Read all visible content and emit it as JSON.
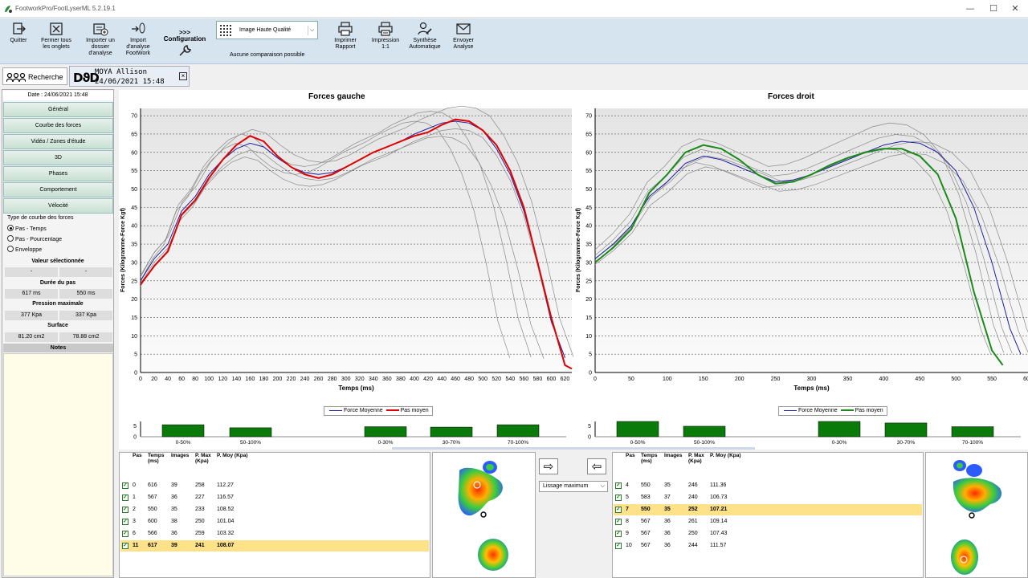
{
  "window": {
    "title": "FootworkPro/FootLyserML 5.2.19.1",
    "minimize": "—",
    "maximize": "☐",
    "close": "✕"
  },
  "ribbon": {
    "quit": "Quitter",
    "close_tabs": [
      "Fermer tous",
      "les onglets"
    ],
    "import_folder": [
      "Importer un",
      "dossier",
      "d'analyse"
    ],
    "import_fw": [
      "Import",
      "d'analyse",
      "FootWork"
    ],
    "config_arrows": ">>>",
    "config": "Configuration",
    "quality": "Image Haute Qualité",
    "no_compare": "Aucune comparaison possible",
    "print_report": [
      "Imprimer",
      "Rapport"
    ],
    "print_11": [
      "Impression",
      "1:1"
    ],
    "synthesis": [
      "Synthèse",
      "Automatique"
    ],
    "send": [
      "Envoyer",
      "Analyse"
    ]
  },
  "tabs": {
    "search": "Recherche",
    "patient_logo": "DϑD",
    "patient_name": "MOYA Allison",
    "patient_date": "24/06/2021 15:48",
    "close": "×"
  },
  "left": {
    "date": "Date : 24/06/2021 15:48",
    "nav": [
      "Général",
      "Courbe des forces",
      "Vidéo / Zones d'étude",
      "3D",
      "Phases",
      "Comportement",
      "Vélocité"
    ],
    "curve_type_title": "Type de courbe des forces",
    "radios": [
      "Pas - Temps",
      "Pas - Pourcentage",
      "Enveloppe"
    ],
    "selected_value_title": "Valeur sélectionnée",
    "selected_values": [
      "-",
      "-"
    ],
    "step_duration_title": "Durée du pas",
    "step_durations": [
      "617 ms",
      "550 ms"
    ],
    "max_pressure_title": "Pression maximale",
    "max_pressures": [
      "377 Kpa",
      "337 Kpa"
    ],
    "surface_title": "Surface",
    "surfaces": [
      "81.20 cm2",
      "78.88 cm2"
    ],
    "notes_title": "Notes"
  },
  "charts": {
    "left_title": "Forces gauche",
    "right_title": "Forces droit",
    "ylabel": "Forces (Kilogramme-Force Kgf)",
    "xlabel": "Temps (ms)",
    "legend_avg": "Force Moyenne",
    "legend_step": "Pas moyen",
    "left_line_color": "#e00000",
    "right_line_color": "#1a8a1a",
    "avg_color": "#2020a0"
  },
  "chart_data": [
    {
      "type": "line",
      "title": "Forces gauche",
      "xlabel": "Temps (ms)",
      "ylabel": "Forces (Kilogramme-Force Kgf)",
      "xlim": [
        0,
        630
      ],
      "ylim": [
        0,
        72
      ],
      "xticks": [
        0,
        20,
        40,
        60,
        80,
        100,
        120,
        140,
        160,
        180,
        200,
        220,
        240,
        260,
        280,
        300,
        320,
        340,
        360,
        380,
        400,
        420,
        440,
        460,
        480,
        500,
        520,
        540,
        560,
        580,
        600,
        620
      ],
      "yticks": [
        0,
        5,
        10,
        15,
        20,
        25,
        30,
        35,
        40,
        45,
        50,
        55,
        60,
        65,
        70
      ],
      "series": [
        {
          "name": "Pas moyen",
          "x": [
            0,
            20,
            40,
            60,
            80,
            100,
            120,
            140,
            160,
            180,
            200,
            220,
            240,
            260,
            280,
            300,
            320,
            340,
            360,
            380,
            400,
            420,
            440,
            460,
            480,
            500,
            520,
            540,
            560,
            580,
            600,
            620,
            630
          ],
          "y": [
            24,
            29,
            33,
            43,
            47,
            53,
            58,
            62,
            64.5,
            63,
            59,
            56,
            54,
            53,
            54,
            56,
            58,
            60,
            61.5,
            63,
            64.5,
            65.5,
            67.5,
            69,
            68.5,
            66,
            62,
            55,
            45,
            30,
            15,
            2,
            1
          ]
        },
        {
          "name": "Force Moyenne",
          "x": [
            0,
            20,
            40,
            60,
            80,
            100,
            120,
            140,
            160,
            180,
            200,
            220,
            240,
            260,
            280,
            300,
            320,
            340,
            360,
            380,
            400,
            420,
            440,
            460,
            480,
            500,
            520,
            540,
            560,
            580,
            600,
            620
          ],
          "y": [
            25,
            31,
            35,
            44,
            48,
            54,
            58,
            61,
            62.5,
            61.5,
            58.5,
            56,
            54.5,
            54,
            54.5,
            56,
            58,
            60,
            61.5,
            63,
            65,
            66.5,
            68,
            68.5,
            68,
            66,
            61,
            54,
            44,
            30,
            14,
            4
          ]
        }
      ]
    },
    {
      "type": "line",
      "title": "Forces droit",
      "xlabel": "Temps (ms)",
      "ylabel": "Forces (Kilogramme-Force Kgf)",
      "xlim": [
        0,
        600
      ],
      "ylim": [
        0,
        72
      ],
      "xticks": [
        0,
        50,
        100,
        150,
        200,
        250,
        300,
        350,
        400,
        450,
        500,
        550,
        600
      ],
      "yticks": [
        0,
        5,
        10,
        15,
        20,
        25,
        30,
        35,
        40,
        45,
        50,
        55,
        60,
        65,
        70
      ],
      "series": [
        {
          "name": "Pas moyen",
          "x": [
            0,
            25,
            50,
            75,
            100,
            125,
            150,
            175,
            200,
            225,
            250,
            275,
            300,
            325,
            350,
            375,
            400,
            425,
            450,
            475,
            500,
            525,
            550,
            565
          ],
          "y": [
            30,
            34,
            39,
            49,
            54,
            60,
            62,
            61,
            58,
            54,
            51.5,
            52,
            54,
            56.5,
            58.5,
            60,
            61,
            61,
            59,
            54,
            42,
            22,
            6,
            2
          ]
        },
        {
          "name": "Force Moyenne",
          "x": [
            0,
            25,
            50,
            75,
            100,
            125,
            150,
            175,
            200,
            225,
            250,
            275,
            300,
            325,
            350,
            375,
            400,
            425,
            450,
            475,
            500,
            525,
            550,
            575,
            590
          ],
          "y": [
            31,
            35,
            40,
            48,
            52,
            57,
            59,
            58,
            56,
            54,
            52,
            52.5,
            54,
            56,
            58,
            60,
            62,
            63,
            62.5,
            60,
            55,
            45,
            30,
            12,
            5
          ]
        }
      ]
    }
  ],
  "phases": {
    "left_labels": [
      "0-50%",
      "50-100%",
      "0-30%",
      "30-70%",
      "70-100%"
    ],
    "right_labels": [
      "0-50%",
      "50-100%",
      "0-30%",
      "30-70%",
      "70-100%"
    ],
    "left_values": [
      5.5,
      4.1,
      4.6,
      4.4,
      5.5
    ],
    "right_values": [
      7.0,
      4.8,
      7.0,
      6.3,
      4.6
    ],
    "yticks": [
      "5",
      "0"
    ],
    "bar_color": "#0a7a0a"
  },
  "left_table": {
    "headers": [
      "Pas",
      "Temps (ms)",
      "Images",
      "P. Max (Kpa)",
      "P. Moy (Kpa)"
    ],
    "rows": [
      {
        "pas": "0",
        "temps": "616",
        "images": "39",
        "pmax": "258",
        "pmoy": "112.27",
        "sel": false
      },
      {
        "pas": "1",
        "temps": "567",
        "images": "36",
        "pmax": "227",
        "pmoy": "116.57",
        "sel": false
      },
      {
        "pas": "2",
        "temps": "550",
        "images": "35",
        "pmax": "233",
        "pmoy": "108.52",
        "sel": false
      },
      {
        "pas": "3",
        "temps": "600",
        "images": "38",
        "pmax": "250",
        "pmoy": "101.04",
        "sel": false
      },
      {
        "pas": "6",
        "temps": "566",
        "images": "36",
        "pmax": "259",
        "pmoy": "103.32",
        "sel": false
      },
      {
        "pas": "11",
        "temps": "617",
        "images": "39",
        "pmax": "241",
        "pmoy": "108.07",
        "sel": true
      }
    ]
  },
  "right_table": {
    "headers": [
      "Pas",
      "Temps (ms)",
      "Images",
      "P. Max (Kpa)",
      "P. Moy (Kpa)"
    ],
    "rows": [
      {
        "pas": "4",
        "temps": "550",
        "images": "35",
        "pmax": "246",
        "pmoy": "111.36",
        "sel": false
      },
      {
        "pas": "5",
        "temps": "583",
        "images": "37",
        "pmax": "240",
        "pmoy": "106.73",
        "sel": false
      },
      {
        "pas": "7",
        "temps": "550",
        "images": "35",
        "pmax": "252",
        "pmoy": "107.21",
        "sel": true
      },
      {
        "pas": "8",
        "temps": "567",
        "images": "36",
        "pmax": "261",
        "pmoy": "109.14",
        "sel": false
      },
      {
        "pas": "9",
        "temps": "567",
        "images": "36",
        "pmax": "250",
        "pmoy": "107.43",
        "sel": false
      },
      {
        "pas": "10",
        "temps": "567",
        "images": "36",
        "pmax": "244",
        "pmoy": "111.57",
        "sel": false
      }
    ]
  },
  "smoothing": "Lissage maximum",
  "arrows": {
    "right": "⇨",
    "left": "⇦"
  }
}
